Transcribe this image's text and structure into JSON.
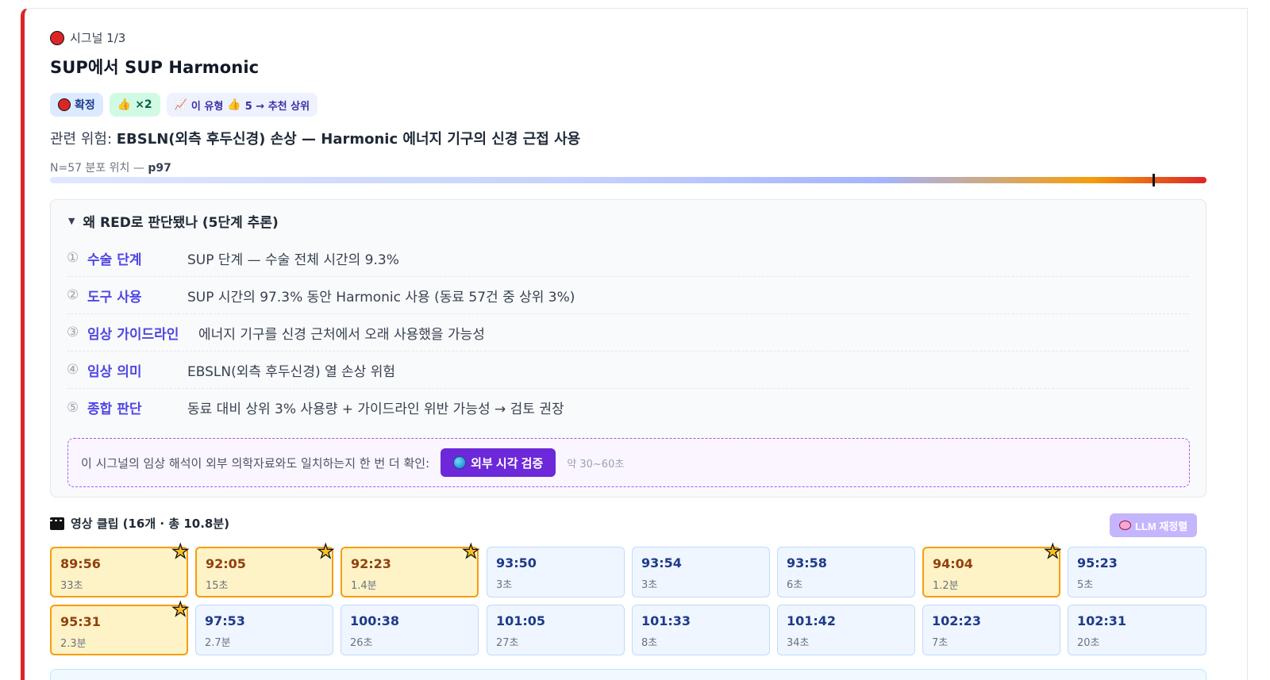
{
  "signal": {
    "label": "시그널 1/3",
    "title": "SUP에서 SUP Harmonic",
    "status_color": "#dc2626",
    "badges": {
      "confirmed": "확정",
      "likes": "×2",
      "trend_prefix": "이 유형",
      "trend_suffix": "5 → 추천 상위"
    },
    "risk_label": "관련 위험:",
    "risk_value": "EBSLN(외측 후두신경) 손상 — Harmonic 에너지 기구의 신경 근접 사용",
    "distribution": {
      "label": "N=57 분포 위치 —",
      "percentile_text": "p97",
      "percentile": 97
    }
  },
  "reasoning": {
    "header": "왜 RED로 판단됐나 (5단계 추론)",
    "steps": [
      {
        "num": "①",
        "key": "수술 단계",
        "value": "SUP 단계 — 수술 전체 시간의 9.3%"
      },
      {
        "num": "②",
        "key": "도구 사용",
        "value": "SUP 시간의 97.3% 동안 Harmonic 사용 (동료 57건 중 상위 3%)"
      },
      {
        "num": "③",
        "key": "임상 가이드라인",
        "value": "에너지 기구를 신경 근처에서 오래 사용했을 가능성"
      },
      {
        "num": "④",
        "key": "임상 의미",
        "value": "EBSLN(외측 후두신경) 열 손상 위험"
      },
      {
        "num": "⑤",
        "key": "종합 판단",
        "value": "동료 대비 상위 3% 사용량 + 가이드라인 위반 가능성 → 검토 권장"
      }
    ],
    "verify_text": "이 시그널의 임상 해석이 외부 의학자료와도 일치하는지 한 번 더 확인:",
    "verify_button": "외부 시각 검증",
    "verify_hint": "약 30~60초"
  },
  "clips": {
    "header": "영상 클립 (16개 · 총 10.8분)",
    "llm_button": "LLM 재정렬",
    "items": [
      {
        "time": "89:56",
        "dur": "33초",
        "starred": true
      },
      {
        "time": "92:05",
        "dur": "15초",
        "starred": true
      },
      {
        "time": "92:23",
        "dur": "1.4분",
        "starred": true
      },
      {
        "time": "93:50",
        "dur": "3초",
        "starred": false
      },
      {
        "time": "93:54",
        "dur": "3초",
        "starred": false
      },
      {
        "time": "93:58",
        "dur": "6초",
        "starred": false
      },
      {
        "time": "94:04",
        "dur": "1.2분",
        "starred": true
      },
      {
        "time": "95:23",
        "dur": "5초",
        "starred": false
      },
      {
        "time": "95:31",
        "dur": "2.3분",
        "starred": true
      },
      {
        "time": "97:53",
        "dur": "2.7분",
        "starred": false
      },
      {
        "time": "100:38",
        "dur": "26초",
        "starred": false
      },
      {
        "time": "101:05",
        "dur": "27초",
        "starred": false
      },
      {
        "time": "101:33",
        "dur": "8초",
        "starred": false
      },
      {
        "time": "101:42",
        "dur": "34초",
        "starred": false
      },
      {
        "time": "102:23",
        "dur": "7초",
        "starred": false
      },
      {
        "time": "102:31",
        "dur": "20초",
        "starred": false
      }
    ]
  }
}
